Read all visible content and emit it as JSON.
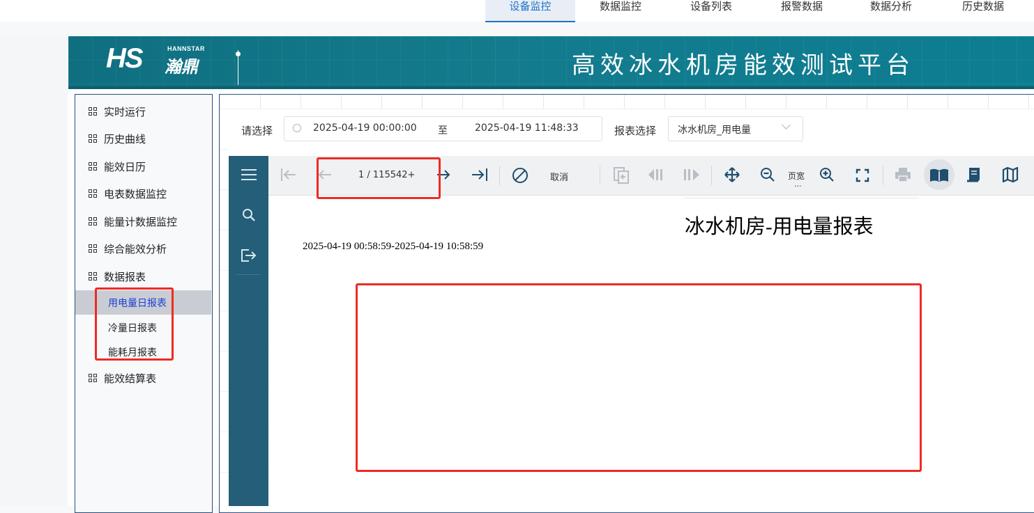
{
  "topnav": {
    "items": [
      {
        "label": "设备监控"
      },
      {
        "label": "数据监控"
      },
      {
        "label": "设备列表"
      },
      {
        "label": "报警数据"
      },
      {
        "label": "数据分析"
      },
      {
        "label": "历史数据"
      }
    ],
    "active_index": 0
  },
  "banner": {
    "logo_text": "HS",
    "logo_brand_en": "HANNSTAR",
    "logo_brand_cn": "瀚鼎",
    "title": "高效冰水机房能效测试平台"
  },
  "sidebar": {
    "items": [
      {
        "label": "实时运行"
      },
      {
        "label": "历史曲线"
      },
      {
        "label": "能效日历"
      },
      {
        "label": "电表数据监控"
      },
      {
        "label": "能量计数据监控"
      },
      {
        "label": "综合能效分析"
      },
      {
        "label": "数据报表"
      },
      {
        "label": "能效结算表"
      }
    ],
    "sub_items": [
      {
        "label": "用电量日报表",
        "selected": true
      },
      {
        "label": "冷量日报表"
      },
      {
        "label": "能耗月报表"
      }
    ]
  },
  "filter": {
    "select_label": "请选择",
    "date_start": "2025-04-19 00:00:00",
    "date_separator": "至",
    "date_end": "2025-04-19 11:48:33",
    "report_label": "报表选择",
    "report_value": "冰水机房_用电量"
  },
  "viewer": {
    "page_indicator": "1 / 115542+",
    "cancel_label": "取消",
    "page_width_label": "页宽",
    "page_width_more": "...",
    "icons": [
      "menu-icon",
      "search-icon",
      "export-icon",
      "first-page-icon",
      "prev-page-icon",
      "next-page-icon",
      "last-page-icon",
      "stop-icon",
      "refresh-icon",
      "prev-frame-icon",
      "next-frame-icon",
      "move-icon",
      "zoom-out-icon",
      "zoom-in-icon",
      "fullscreen-icon",
      "print-icon",
      "open-book-icon",
      "continuous-icon",
      "map-icon"
    ]
  },
  "report": {
    "title": "冰水机房-用电量报表",
    "range": "2025-04-19 00:58:59-2025-04-19 10:58:59"
  },
  "colors": {
    "banner": "#137b8d",
    "viewer_side": "#245e78",
    "highlight_red": "#ee2a24",
    "nav_active": "#1e73c8"
  }
}
